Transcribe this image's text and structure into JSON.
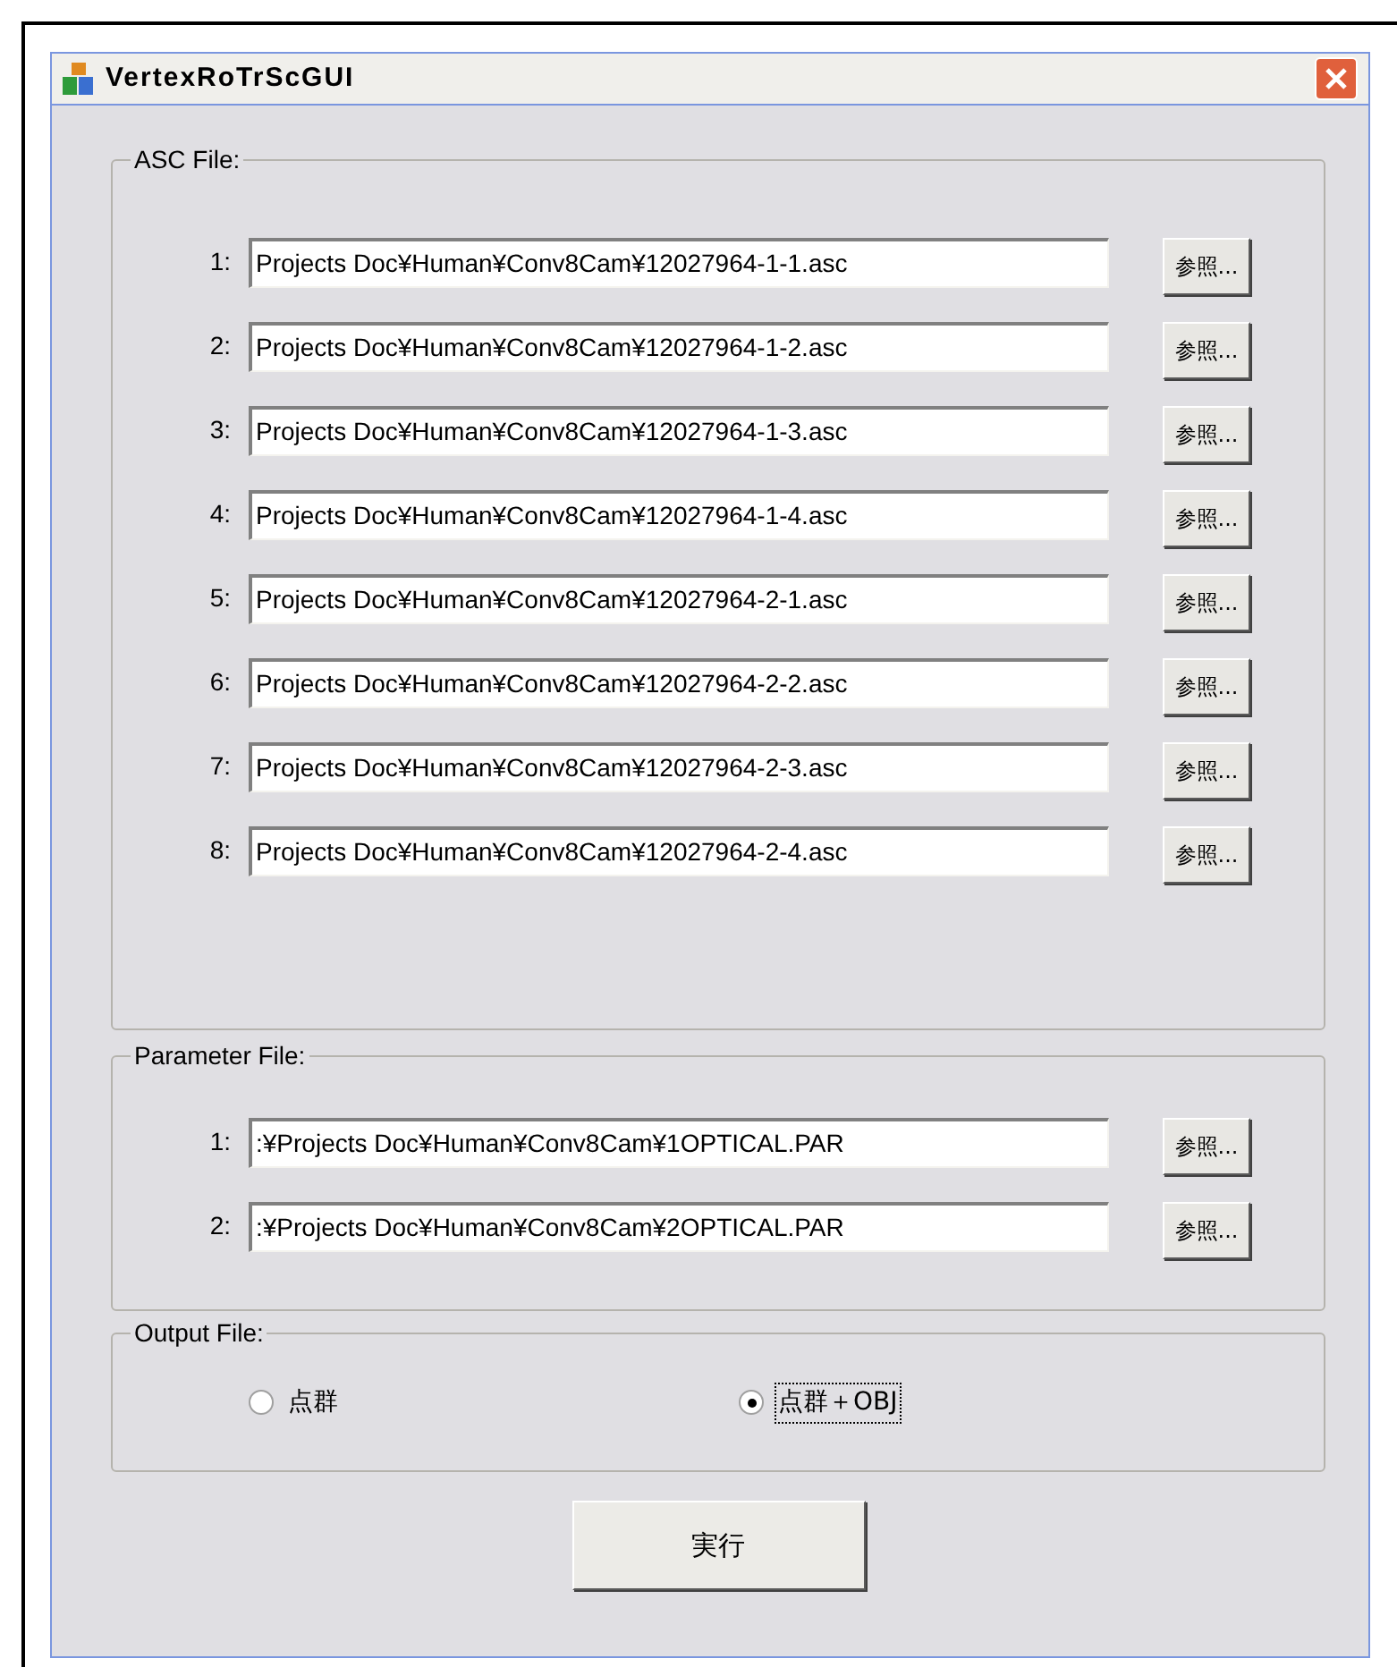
{
  "window": {
    "title": "VertexRoTrScGUI"
  },
  "asc_group": {
    "title": "ASC File:",
    "rows": [
      {
        "label": "1:",
        "value": "Projects Doc¥Human¥Conv8Cam¥12027964-1-1.asc",
        "button": "参照..."
      },
      {
        "label": "2:",
        "value": "Projects Doc¥Human¥Conv8Cam¥12027964-1-2.asc",
        "button": "参照..."
      },
      {
        "label": "3:",
        "value": "Projects Doc¥Human¥Conv8Cam¥12027964-1-3.asc",
        "button": "参照..."
      },
      {
        "label": "4:",
        "value": "Projects Doc¥Human¥Conv8Cam¥12027964-1-4.asc",
        "button": "参照..."
      },
      {
        "label": "5:",
        "value": "Projects Doc¥Human¥Conv8Cam¥12027964-2-1.asc",
        "button": "参照..."
      },
      {
        "label": "6:",
        "value": "Projects Doc¥Human¥Conv8Cam¥12027964-2-2.asc",
        "button": "参照..."
      },
      {
        "label": "7:",
        "value": "Projects Doc¥Human¥Conv8Cam¥12027964-2-3.asc",
        "button": "参照..."
      },
      {
        "label": "8:",
        "value": "Projects Doc¥Human¥Conv8Cam¥12027964-2-4.asc",
        "button": "参照..."
      }
    ]
  },
  "parameter_group": {
    "title": "Parameter File:",
    "rows": [
      {
        "label": "1:",
        "value": ":¥Projects Doc¥Human¥Conv8Cam¥1OPTICAL.PAR",
        "button": "参照..."
      },
      {
        "label": "2:",
        "value": ":¥Projects Doc¥Human¥Conv8Cam¥2OPTICAL.PAR",
        "button": "参照..."
      }
    ]
  },
  "output_group": {
    "title": "Output File:",
    "options": [
      {
        "label": "点群",
        "selected": false
      },
      {
        "label": "点群＋OBJ",
        "selected": true
      }
    ]
  },
  "run_button": "実行"
}
